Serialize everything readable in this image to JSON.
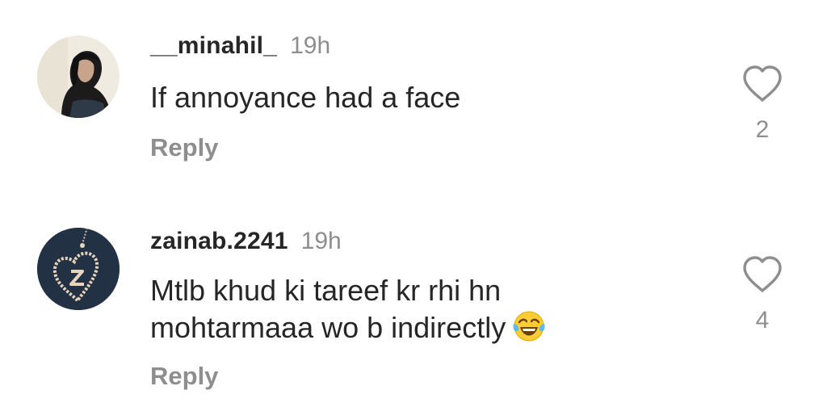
{
  "comments": [
    {
      "username": "__minahil_",
      "time": "19h",
      "text": "If annoyance had a face",
      "reply_label": "Reply",
      "like_count": "2",
      "avatar_icon": "profile-photo-avatar"
    },
    {
      "username": "zainab.2241",
      "time": "19h",
      "text_lines": [
        "Mtlb khud ki tareef kr rhi hn",
        "mohtarmaaa wo b indirectly"
      ],
      "emoji": "face-with-tears-of-joy",
      "reply_label": "Reply",
      "like_count": "4",
      "avatar_icon": "heart-pendant-avatar"
    }
  ],
  "icons": {
    "like": "heart-outline-icon"
  },
  "colors": {
    "primary_text": "#262626",
    "secondary_text": "#8e8e8e",
    "background": "#ffffff"
  }
}
